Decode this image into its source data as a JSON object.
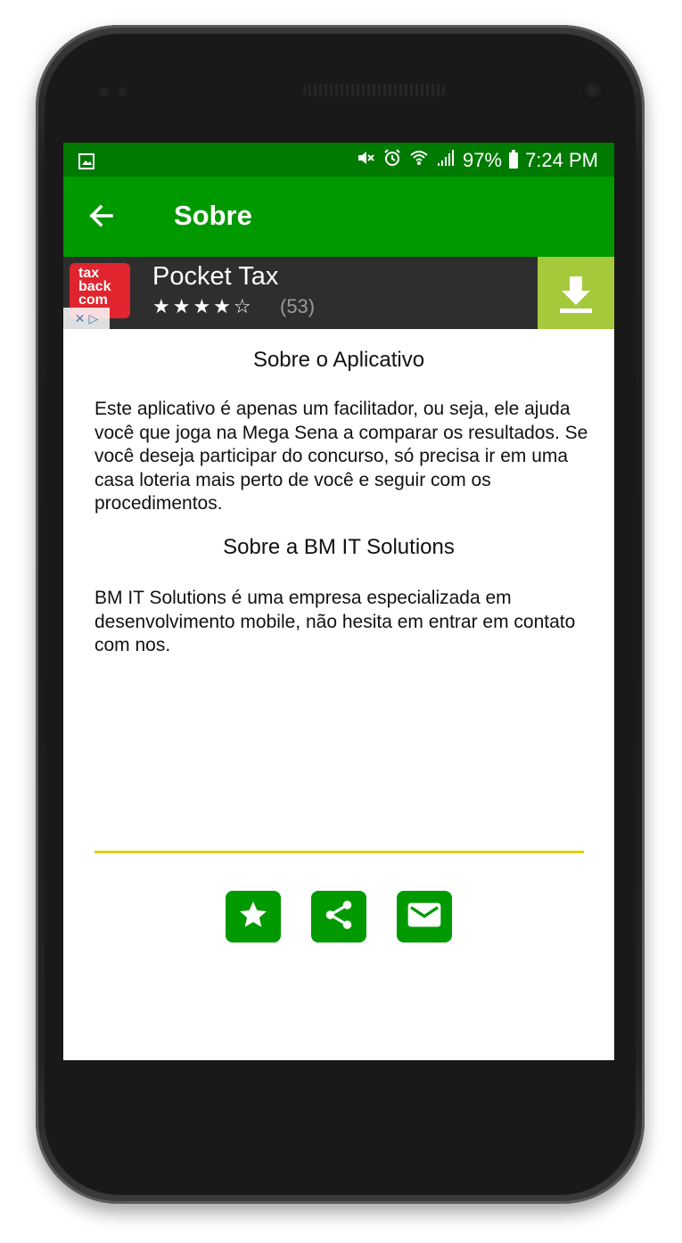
{
  "status_bar": {
    "battery": "97%",
    "time": "7:24 PM"
  },
  "app_bar": {
    "title": "Sobre"
  },
  "ad": {
    "logo_text": "tax back com",
    "app_name": "Pocket Tax",
    "stars": "★★★★☆",
    "rating_count": "(53)"
  },
  "about_app": {
    "heading": "Sobre o Aplicativo",
    "text": "Este aplicativo é apenas um facilitador, ou seja, ele ajuda você que joga na Mega Sena a comparar os resultados. Se você deseja participar do concurso, só precisa ir em uma casa loteria mais perto de você e seguir com os procedimentos."
  },
  "about_company": {
    "heading": "Sobre a BM IT Solutions",
    "text": "BM IT Solutions é uma empresa especializada em desenvolvimento mobile, não hesita em entrar em contato com nos."
  },
  "colors": {
    "status_bar": "#007a00",
    "app_bar": "#009a00",
    "divider": "#e7cf00",
    "download": "#a5c93a",
    "ad_logo": "#e0252e"
  },
  "icons": [
    "image-icon",
    "mute-icon",
    "alarm-icon",
    "wifi-icon",
    "signal-icon",
    "battery-icon",
    "back-arrow-icon",
    "download-icon",
    "star-icon",
    "share-icon",
    "mail-icon"
  ]
}
